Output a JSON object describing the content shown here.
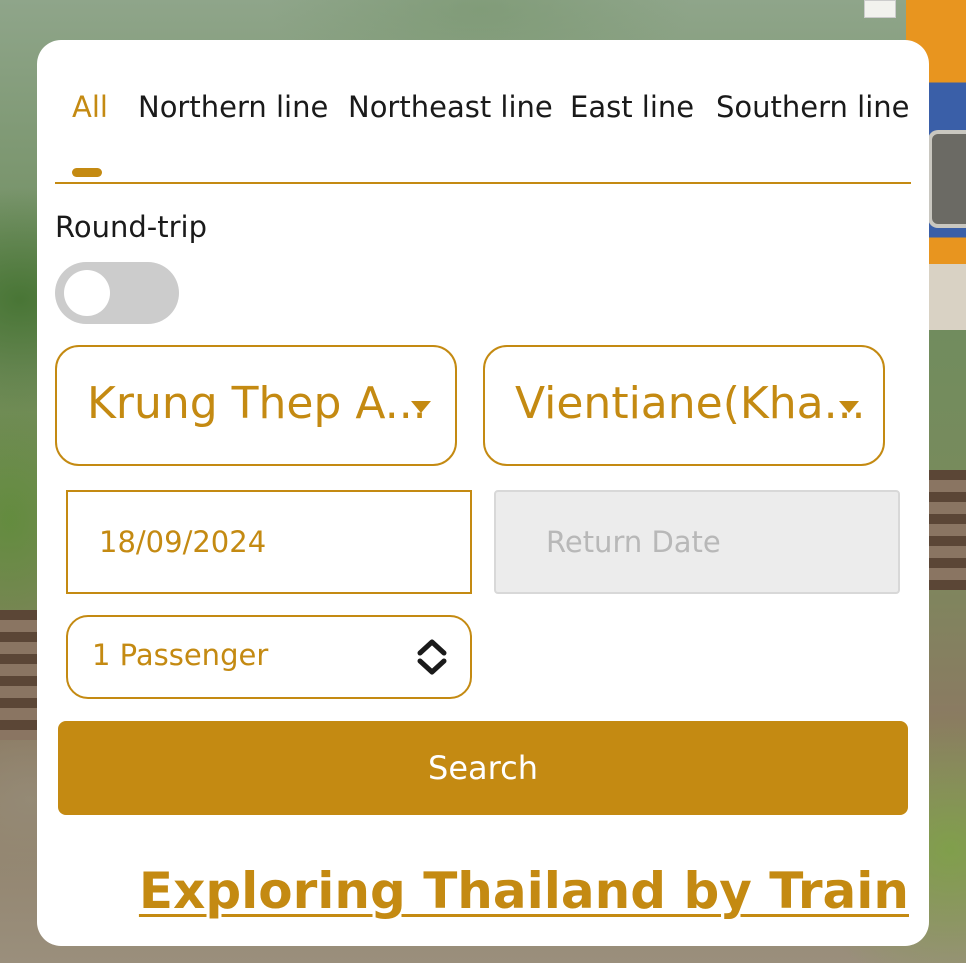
{
  "tabs": {
    "all": "All",
    "northern": "Northern line",
    "northeast": "Northeast line",
    "east": "East line",
    "southern": "Southern line",
    "active": "All"
  },
  "round_trip": {
    "label": "Round-trip",
    "enabled": false
  },
  "route": {
    "origin": "Krung Thep A...",
    "destination": "Vientiane(Kha..."
  },
  "dates": {
    "depart_value": "18/09/2024",
    "return_placeholder": "Return Date"
  },
  "passengers": {
    "value": "1 Passenger"
  },
  "search_button": "Search",
  "explore_link": "Exploring Thailand by Train",
  "colors": {
    "accent": "#c48a12",
    "toggle_off": "#cccccc",
    "disabled_field": "#ececec"
  },
  "icons": {
    "dropdown": "caret-down-icon",
    "stepper": "chevron-up-down-icon"
  }
}
